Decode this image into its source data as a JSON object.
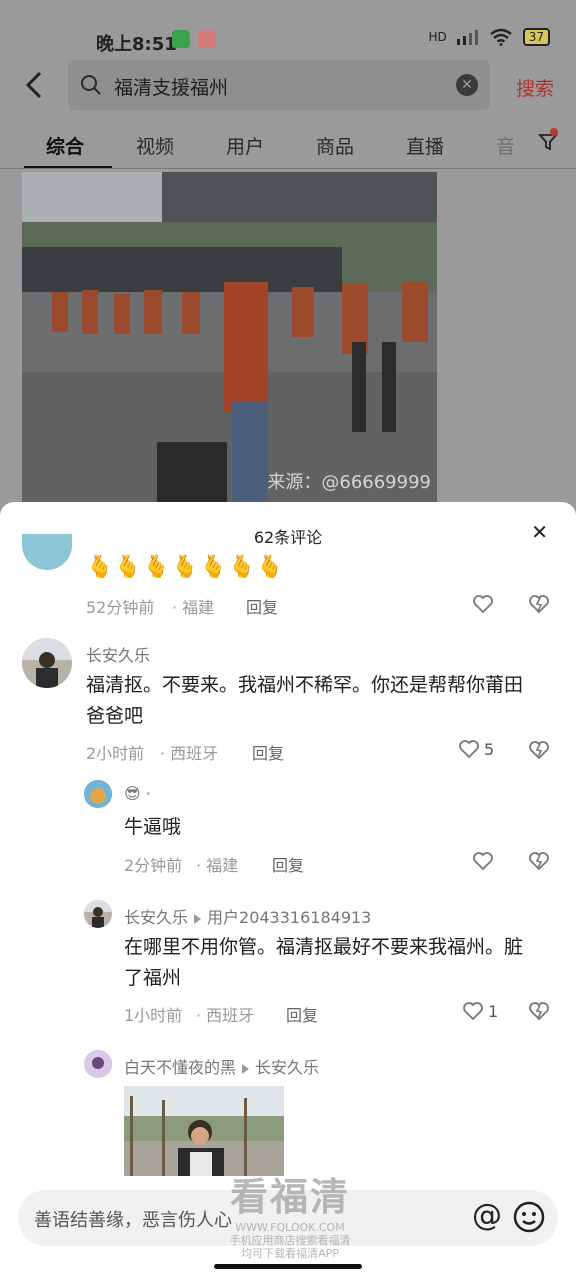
{
  "status": {
    "time": "晚上8:51",
    "network": "HD",
    "battery": "37"
  },
  "search": {
    "query": "福清支援福州",
    "button": "搜索"
  },
  "tabs": [
    "综合",
    "视频",
    "用户",
    "商品",
    "直播",
    "音"
  ],
  "video": {
    "source": "来源：@66669999"
  },
  "sheet": {
    "title": "62条评论"
  },
  "comments": [
    {
      "emoji_row": "🫰🫰🫰🫰🫰🫰🫰",
      "time": "52分钟前",
      "location": "福建",
      "reply": "回复"
    },
    {
      "name": "长安久乐",
      "text_line1": "福清抠。不要来。我福州不稀罕。你还是帮帮你莆田",
      "text_line2": "爸爸吧",
      "time": "2小时前",
      "location": "西班牙",
      "reply": "回复",
      "likes": "5"
    },
    {
      "name": "😎 ·",
      "text": "牛逼哦",
      "time": "2分钟前",
      "location": "福建",
      "reply": "回复"
    },
    {
      "name": "长安久乐",
      "reply_to": "用户2043316184913",
      "text_line1": "在哪里不用你管。福清抠最好不要来我福州。脏",
      "text_line2": "了福州",
      "time": "1小时前",
      "location": "西班牙",
      "reply": "回复",
      "likes": "1"
    },
    {
      "name": "白天不懂夜的黑",
      "reply_to": "长安久乐"
    }
  ],
  "input": {
    "placeholder": "善语结善缘，恶言伤人心"
  },
  "watermark": {
    "title": "看福清",
    "url": "WWW.FQLOOK.COM",
    "line1": "手机应用商店搜索看福清",
    "line2": "均可下载看福清APP"
  }
}
